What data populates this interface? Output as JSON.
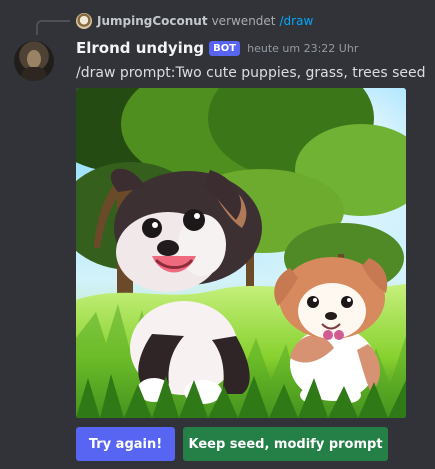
{
  "reply": {
    "username": "JumpingCoconut",
    "verb": "verwendet",
    "command": "/draw"
  },
  "message": {
    "author": "Elrond undying",
    "bot_tag": "BOT",
    "timestamp": "heute um 23:22 Uhr",
    "content": "/draw prompt:Two cute puppies, grass, trees seed"
  },
  "buttons": {
    "try_again": "Try again!",
    "keep_seed": "Keep seed, modify prompt"
  },
  "colors": {
    "background": "#313338",
    "bot_tag": "#5865f2",
    "primary_button": "#5865f2",
    "success_button": "#248046",
    "command_link": "#00a8fc"
  },
  "icons": {
    "reply_avatar": "user-avatar",
    "bot_avatar": "user-avatar",
    "image": "generated-image"
  }
}
